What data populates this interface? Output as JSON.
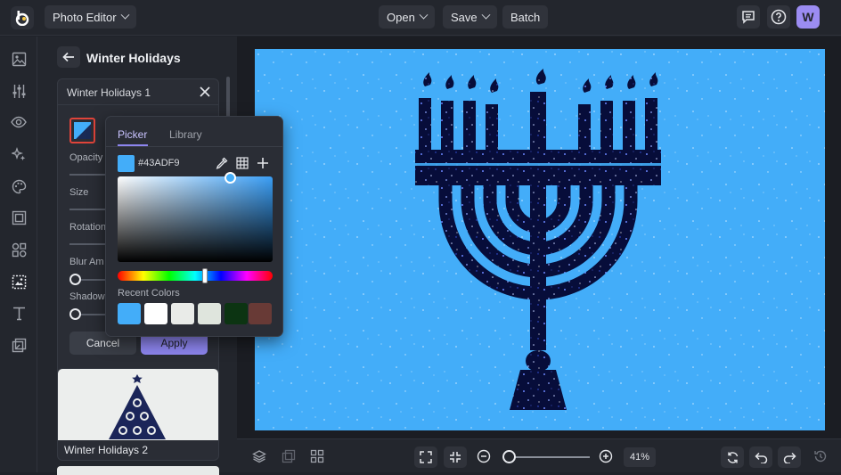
{
  "topbar": {
    "app_menu_label": "Photo Editor",
    "open_label": "Open",
    "save_label": "Save",
    "batch_label": "Batch",
    "avatar_letter": "W"
  },
  "panel": {
    "title": "Winter Holidays",
    "card_title": "Winter Holidays 1",
    "opacity_label": "Opacity",
    "size_label": "Size",
    "rotation_label": "Rotation",
    "blur_label": "Blur Am",
    "shadow_label": "Shadow",
    "cancel_label": "Cancel",
    "apply_label": "Apply",
    "next_item_label": "Winter Holidays 2"
  },
  "color_picker": {
    "tab_picker": "Picker",
    "tab_library": "Library",
    "hex_value": "#43ADF9",
    "recent_label": "Recent Colors",
    "selected_color": "#43adf9",
    "recent_colors": [
      "#43adf9",
      "#ffffff",
      "#e9ebe8",
      "#dfe5dd",
      "#0c3412",
      "#683a36"
    ]
  },
  "canvas": {
    "background_color": "#43adf9",
    "graphic": "menorah-icon"
  },
  "bottombar": {
    "zoom_value": "41%"
  }
}
